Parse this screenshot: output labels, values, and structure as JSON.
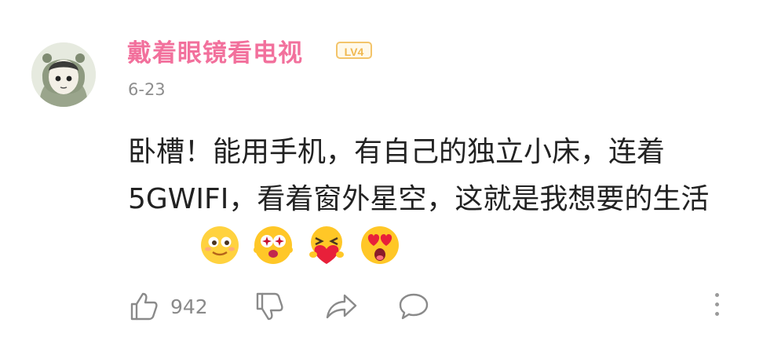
{
  "comment": {
    "username": "戴着眼镜看电视",
    "level": "LV4",
    "date": "6-23",
    "text": "卧槽！能用手机，有自己的独立小床，连着5GWIFI，看着窗外星空，这就是我想要的生活",
    "emojis": [
      "smiling-face-emoji",
      "star-eyed-face-emoji",
      "hugging-heart-emoji",
      "heart-eyes-emoji"
    ]
  },
  "actions": {
    "like_icon": "thumbs-up-icon",
    "like_count": "942",
    "dislike_icon": "thumbs-down-icon",
    "share_icon": "share-arrow-icon",
    "reply_icon": "speech-bubble-icon",
    "more_icon": "more-vertical-icon"
  },
  "colors": {
    "username": "#f2709c",
    "level_badge": "#f0b84f",
    "date": "#8d8d8d",
    "text": "#222222",
    "icons": "#8a8a8a"
  }
}
